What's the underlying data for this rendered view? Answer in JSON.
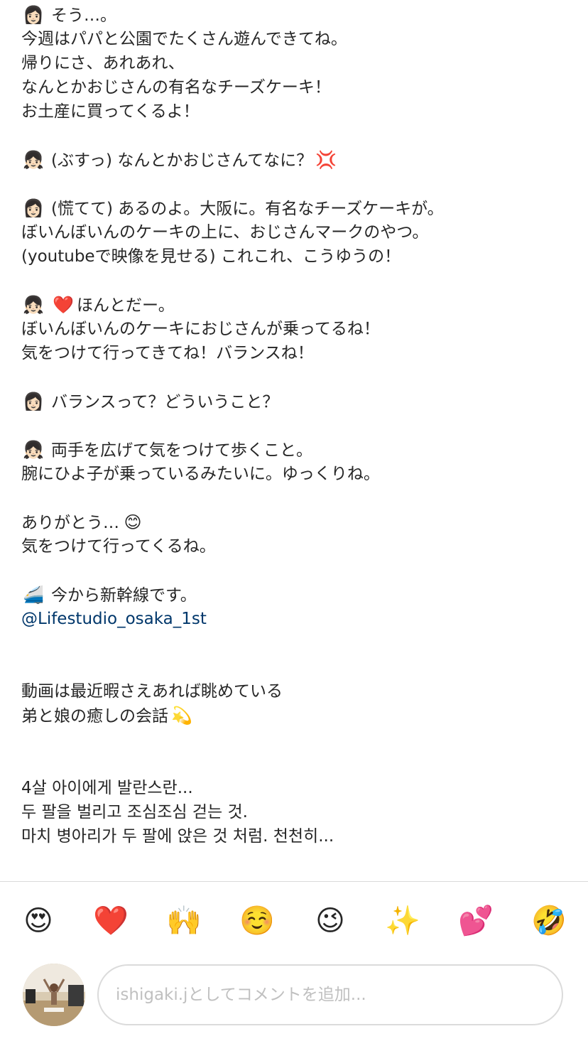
{
  "caption": {
    "l1": "そう…。",
    "l2": "今週はパパと公園でたくさん遊んできてね。",
    "l3": "帰りにさ、あれあれ、",
    "l4": "なんとかおじさんの有名なチーズケーキ！",
    "l5": "お土産に買ってくるよ！",
    "l6": "(ぶすっ) なんとかおじさんてなに？",
    "l7": "(慌てて) あるのよ。大阪に。有名なチーズケーキが。",
    "l8": "ぼいんぼいんのケーキの上に、おじさんマークのやつ。",
    "l9": "(youtubeで映像を見せる) これこれ、こうゆうの！",
    "l10": "ほんとだー。",
    "l11": "ぼいんぼいんのケーキにおじさんが乗ってるね！",
    "l12": "気をつけて行ってきてね！バランスね！",
    "l13": "バランスって？どういうこと？",
    "l14": "両手を広げて気をつけて歩くこと。",
    "l15": "腕にひよ子が乗っているみたいに。ゆっくりね。",
    "l16": "ありがとう…",
    "l17": "気をつけて行ってくるね。",
    "l18": "今から新幹線です。",
    "mention": "@Lifestudio_osaka_1st",
    "l19": "動画は最近暇さえあれば眺めている",
    "l20": "弟と娘の癒しの会話",
    "l21": "4살 아이에게 발란스란...",
    "l22": "두 팔을 벌리고 조심조심 걷는 것.",
    "l23": "마치 병아리가 두 팔에 앉은 것 처럼. 천천히..."
  },
  "caption_emojis": {
    "mom": "👩🏻",
    "girl": "👧🏻",
    "anger": "💢",
    "heart": "❤️",
    "smile": "😊",
    "train": "🚄",
    "dizzy": "💫"
  },
  "reactions": [
    "😍",
    "❤️",
    "🙌",
    "☺️",
    "😉",
    "✨",
    "💕",
    "🤣"
  ],
  "comment": {
    "placeholder": "ishigaki.jとしてコメントを追加..."
  },
  "colors": {
    "mention": "#00376b",
    "divider": "#dbdbdb",
    "placeholder": "#c0c0c0"
  }
}
